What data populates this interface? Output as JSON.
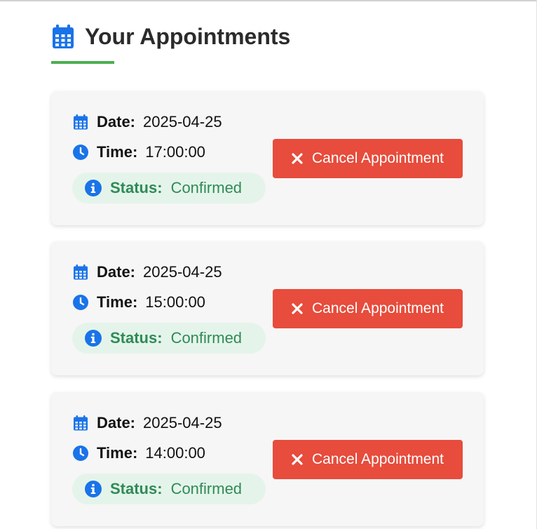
{
  "page": {
    "title": "Your Appointments"
  },
  "labels": {
    "date": "Date:",
    "time": "Time:",
    "status": "Status:",
    "cancel": "Cancel Appointment"
  },
  "appointments": [
    {
      "date": "2025-04-25",
      "time": "17:00:00",
      "status": "Confirmed"
    },
    {
      "date": "2025-04-25",
      "time": "15:00:00",
      "status": "Confirmed"
    },
    {
      "date": "2025-04-25",
      "time": "14:00:00",
      "status": "Confirmed"
    }
  ],
  "colors": {
    "accent_icon": "#1a73e8",
    "underline": "#4caf50",
    "cancel_button": "#e74c3c",
    "status_text": "#2e8b57",
    "status_bg": "#e5f4ea"
  },
  "icons": {
    "header": "calendar-icon",
    "date": "calendar-icon",
    "time": "clock-icon",
    "status": "info-icon",
    "cancel": "close-icon"
  }
}
